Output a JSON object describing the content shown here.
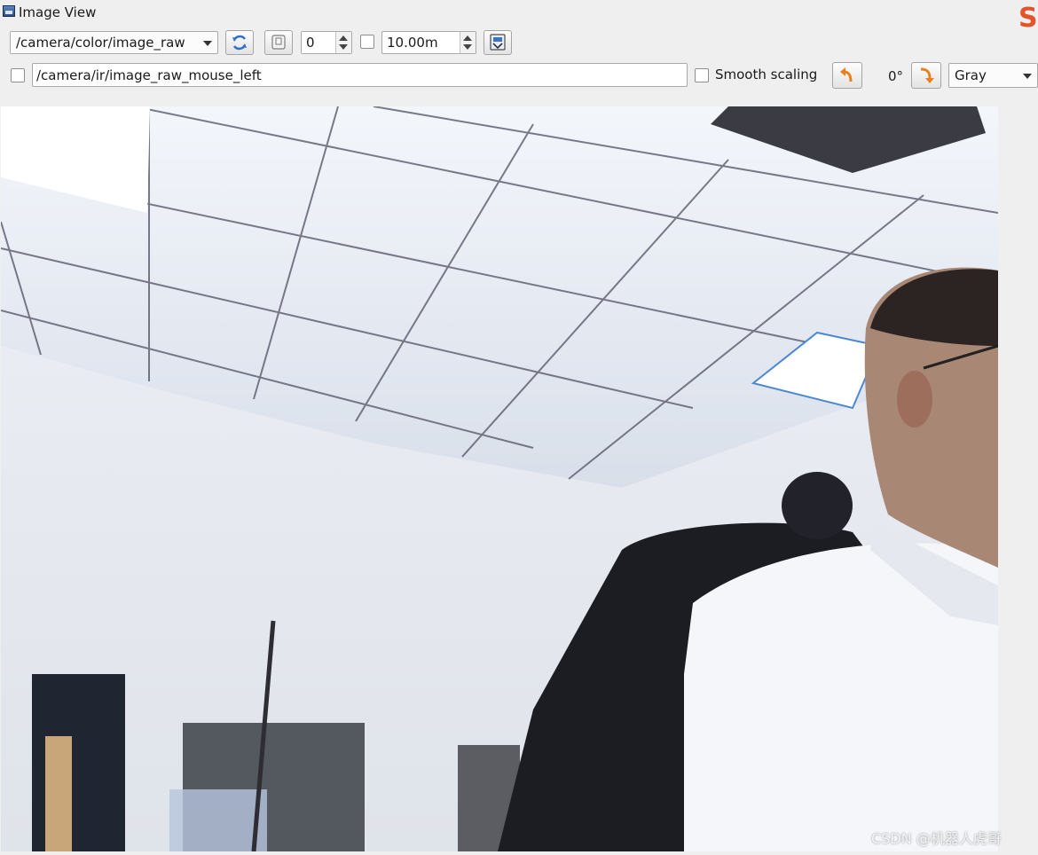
{
  "window": {
    "title": "Image View",
    "corner_logo": "S"
  },
  "toolbar": {
    "topic_select": {
      "selected": "/camera/color/image_raw"
    },
    "refresh_icon": "refresh-icon",
    "save_icon": "save-image-icon",
    "zoom_value": "0",
    "max_range_value": "10.00m",
    "max_range_checked": false,
    "export_icon": "export-icon"
  },
  "row2": {
    "mouse_publish_checked": false,
    "mouse_topic_value": "/camera/ir/image_raw_mouse_left",
    "smooth_scaling_label": "Smooth scaling",
    "smooth_scaling_checked": false,
    "rotate_left_icon": "rotate-left-icon",
    "rotation_label": "0°",
    "rotate_right_icon": "rotate-right-icon",
    "color_scheme_select": {
      "selected": "Gray"
    }
  },
  "image": {
    "description_icon": "camera-image",
    "watermark": "CSDN @机器人虎哥"
  },
  "colors": {
    "window_bg": "#efefef",
    "rotate_button_arrow": "#e8801e",
    "refresh_icon": "#2f6fc4"
  }
}
